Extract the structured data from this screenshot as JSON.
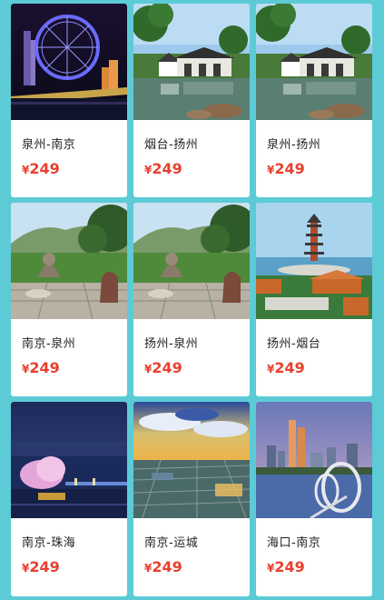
{
  "currency": "¥",
  "routes": [
    {
      "title": "泉州-南京",
      "price": "249",
      "image": "night-ferris-wheel-photo"
    },
    {
      "title": "烟台-扬州",
      "price": "249",
      "image": "garden-pavilion-photo"
    },
    {
      "title": "泉州-扬州",
      "price": "249",
      "image": "garden-pavilion-photo"
    },
    {
      "title": "南京-泉州",
      "price": "249",
      "image": "stone-statue-park-photo"
    },
    {
      "title": "扬州-泉州",
      "price": "249",
      "image": "stone-statue-park-photo"
    },
    {
      "title": "扬州-烟台",
      "price": "249",
      "image": "pagoda-island-photo"
    },
    {
      "title": "南京-珠海",
      "price": "249",
      "image": "night-bay-opera-photo"
    },
    {
      "title": "南京-运城",
      "price": "249",
      "image": "salt-lake-sunset-photo"
    },
    {
      "title": "海口-南京",
      "price": "249",
      "image": "city-skyline-ring-photo"
    }
  ]
}
